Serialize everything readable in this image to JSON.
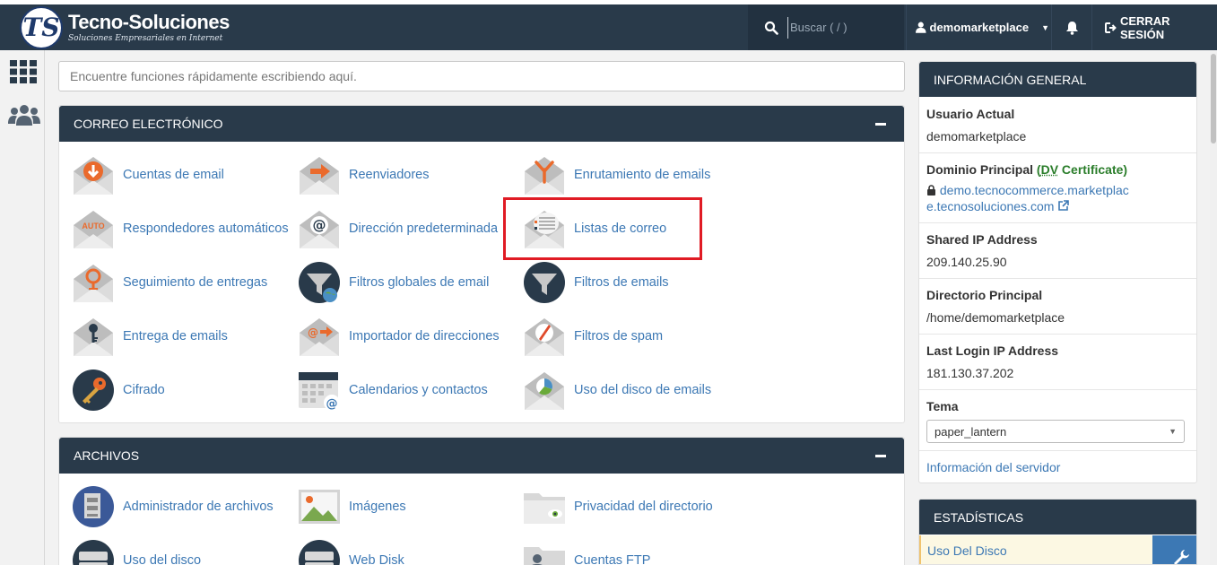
{
  "header": {
    "brand_initials": "TS",
    "brand_name": "Tecno-Soluciones",
    "brand_tagline": "Soluciones Empresariales en Internet",
    "search_placeholder": "Buscar ( / )",
    "username": "demomarketplace",
    "logout_label": "CERRAR SESIÓN"
  },
  "quick_search": {
    "placeholder": "Encuentre funciones rápidamente escribiendo aquí."
  },
  "email_panel": {
    "title": "CORREO ELECTRÓNICO",
    "items": [
      {
        "label": "Cuentas de email",
        "icon": "email-accounts-icon"
      },
      {
        "label": "Reenviadores",
        "icon": "forwarders-icon"
      },
      {
        "label": "Enrutamiento de emails",
        "icon": "email-routing-icon"
      },
      {
        "label": "Respondedores automáticos",
        "icon": "autoresponders-icon"
      },
      {
        "label": "Dirección predeterminada",
        "icon": "default-address-icon"
      },
      {
        "label": "Listas de correo",
        "icon": "mailing-lists-icon"
      },
      {
        "label": "Seguimiento de entregas",
        "icon": "track-delivery-icon"
      },
      {
        "label": "Filtros globales de email",
        "icon": "global-email-filters-icon"
      },
      {
        "label": "Filtros de emails",
        "icon": "email-filters-icon"
      },
      {
        "label": "Entrega de emails",
        "icon": "email-deliverability-icon"
      },
      {
        "label": "Importador de direcciones",
        "icon": "address-importer-icon"
      },
      {
        "label": "Filtros de spam",
        "icon": "spam-filters-icon"
      },
      {
        "label": "Cifrado",
        "icon": "encryption-icon"
      },
      {
        "label": "Calendarios y contactos",
        "icon": "calendars-contacts-icon"
      },
      {
        "label": "Uso del disco de emails",
        "icon": "email-disk-usage-icon"
      }
    ]
  },
  "files_panel": {
    "title": "ARCHIVOS",
    "items": [
      {
        "label": "Administrador de archivos",
        "icon": "file-manager-icon"
      },
      {
        "label": "Imágenes",
        "icon": "images-icon"
      },
      {
        "label": "Privacidad del directorio",
        "icon": "directory-privacy-icon"
      },
      {
        "label": "Uso del disco",
        "icon": "disk-usage-icon"
      },
      {
        "label": "Web Disk",
        "icon": "web-disk-icon"
      },
      {
        "label": "Cuentas FTP",
        "icon": "ftp-accounts-icon"
      }
    ]
  },
  "general_info": {
    "title": "INFORMACIÓN GENERAL",
    "current_user_label": "Usuario Actual",
    "current_user": "demomarketplace",
    "main_domain_label": "Dominio Principal",
    "dv_prefix": "(",
    "dv_abbr": "DV",
    "dv_suffix": " Certificate)",
    "main_domain_line1": "demo.tecnocommerce.marketplac",
    "main_domain_line2": "e.tecnosoluciones.com",
    "shared_ip_label": "Shared IP Address",
    "shared_ip": "209.140.25.90",
    "home_dir_label": "Directorio Principal",
    "home_dir": "/home/demomarketplace",
    "last_login_label": "Last Login IP Address",
    "last_login_ip": "181.130.37.202",
    "theme_label": "Tema",
    "theme_value": "paper_lantern",
    "server_info_link": "Información del servidor"
  },
  "stats": {
    "title": "ESTADÍSTICAS",
    "first_row": "Uso Del Disco"
  },
  "colors": {
    "header_bg": "#293a4a",
    "link": "#3c78b4",
    "highlight": "#e01b24",
    "icon_orange": "#ea6a2c"
  }
}
